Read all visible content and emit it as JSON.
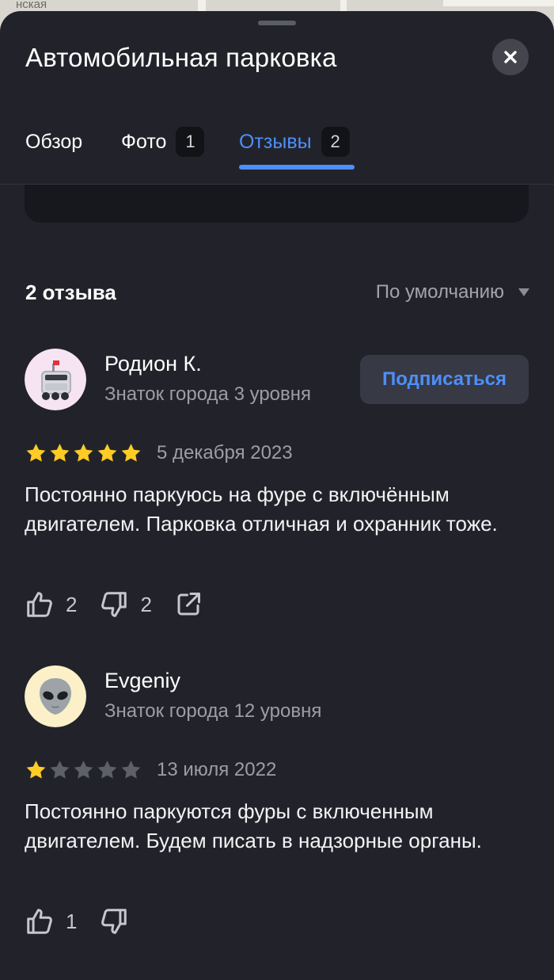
{
  "map": {
    "label": "нская"
  },
  "header": {
    "title": "Автомобильная парковка",
    "close_icon": "close-icon"
  },
  "tabs": [
    {
      "label": "Обзор",
      "count": ""
    },
    {
      "label": "Фото",
      "count": "1"
    },
    {
      "label": "Отзывы",
      "count": "2",
      "active": true
    }
  ],
  "reviews_header": {
    "count_label": "2 отзыва",
    "sort_label": "По умолчанию"
  },
  "reviews": [
    {
      "author": "Родион К.",
      "badge": "Знаток города 3 уровня",
      "avatar_icon": "delivery-robot-icon",
      "subscribe_label": "Подписаться",
      "rating": 5,
      "date": "5 декабря 2023",
      "text": "Постоянно паркуюсь на фуре с включённым двигателем. Парковка отличная и охранник тоже.",
      "likes": "2",
      "dislikes": "2"
    },
    {
      "author": "Evgeniy",
      "badge": "Знаток города 12 уровня",
      "avatar_icon": "alien-icon",
      "rating": 1,
      "date": "13 июля 2022",
      "text": "Постоянно паркуются фуры с включенным двигателем. Будем писать в надзорные органы.",
      "likes": "1",
      "dislikes": ""
    }
  ],
  "colors": {
    "background": "#22232a",
    "accent": "#4d8ffb",
    "star_filled": "#ffcc26",
    "star_empty": "#5e6068",
    "muted_text": "#9d9ea5"
  }
}
